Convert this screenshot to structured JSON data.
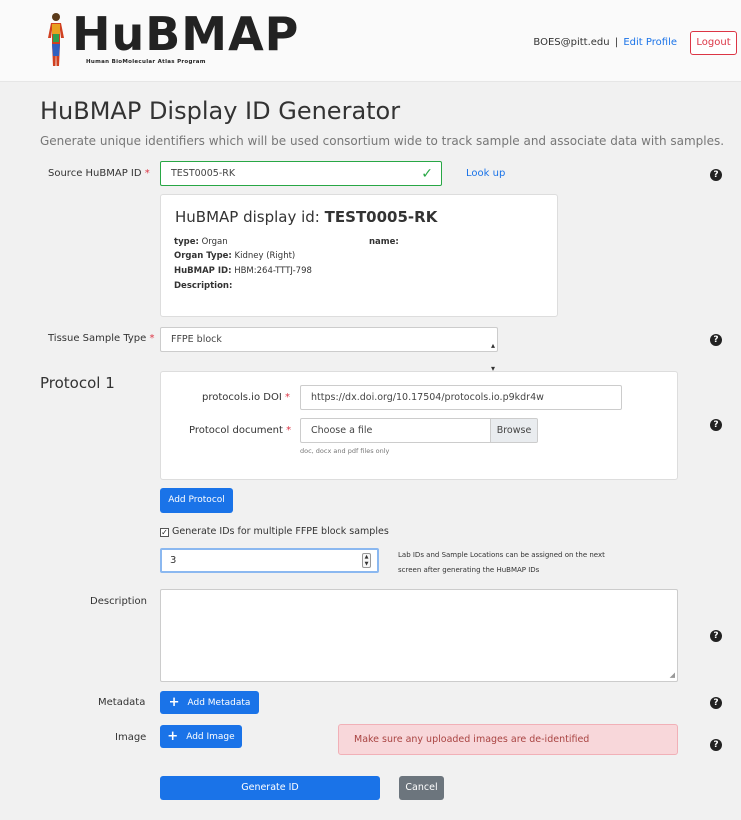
{
  "header": {
    "logo": {
      "text": "HuBMAP",
      "tagline": "Human BioMolecular Atlas Program"
    },
    "user_email": "BOES@pitt.edu",
    "separator": "|",
    "edit_profile": "Edit Profile",
    "logout": "Logout"
  },
  "page": {
    "title": "HuBMAP Display ID Generator",
    "subtitle": "Generate unique identifiers which will be used consortium wide to track sample and associate data with samples."
  },
  "source": {
    "label": "Source HuBMAP ID",
    "required": "*",
    "value": "TEST0005-RK",
    "lookup": "Look up",
    "display_prefix": "HuBMAP display id:",
    "display_id": "TEST0005-RK",
    "type_label": "type:",
    "type_value": "Organ",
    "name_label": "name:",
    "organ_type_label": "Organ Type:",
    "organ_type_value": "Kidney (Right)",
    "hubmap_id_label": "HuBMAP ID:",
    "hubmap_id_value": "HBM:264-TTTJ-798",
    "description_label": "Description:"
  },
  "tissue": {
    "label": "Tissue Sample Type",
    "required": "*",
    "selected": "FFPE block"
  },
  "protocol": {
    "title": "Protocol 1",
    "doi_label": "protocols.io DOI",
    "doi_value": "https://dx.doi.org/10.17504/protocols.io.p9kdr4w",
    "doc_label": "Protocol document",
    "doc_placeholder": "Choose a file",
    "browse": "Browse",
    "doc_hint": "doc, docx and pdf files only",
    "required": "*",
    "add_protocol": "Add Protocol"
  },
  "multi": {
    "checkbox_label": "Generate IDs for multiple FFPE block samples",
    "count": "3",
    "note_line1": "Lab IDs and Sample Locations can be assigned on the next",
    "note_line2": "screen after generating the HuBMAP IDs"
  },
  "description": {
    "label": "Description"
  },
  "metadata": {
    "label": "Metadata",
    "button": "Add Metadata"
  },
  "image": {
    "label": "Image",
    "button": "Add Image",
    "warning": "Make sure any uploaded images are de-identified"
  },
  "actions": {
    "generate": "Generate ID",
    "cancel": "Cancel"
  },
  "help_glyph": "?",
  "colors": {
    "primary": "#1a73e8",
    "danger": "#dc3545",
    "success": "#28a745",
    "alert_bg": "#f8d7da"
  }
}
